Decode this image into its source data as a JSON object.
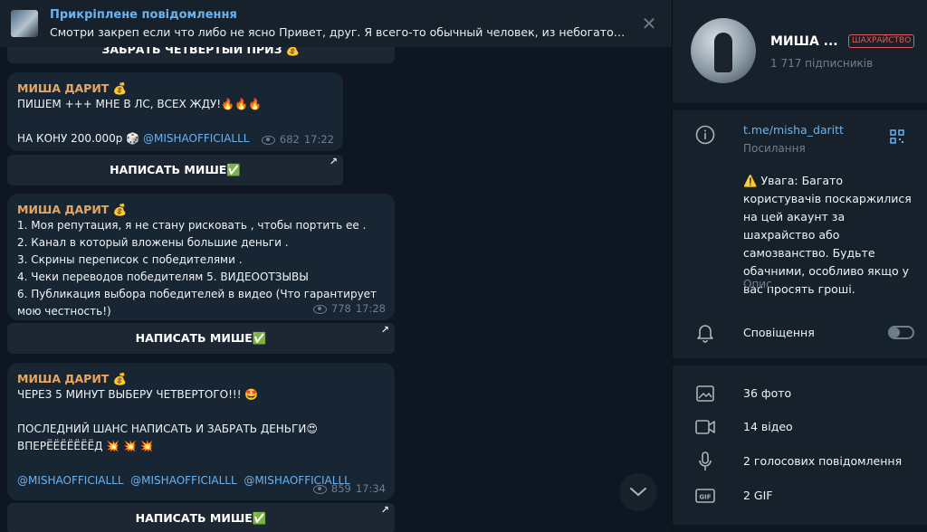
{
  "pinned": {
    "title": "Прикріплене повідомлення",
    "text": "Смотри закреп если что либо не ясно  Привет, друг. Я всего-то обычный человек, из небогатой сем..."
  },
  "top_button_label": "ЗАБРАТЬ ЧЕТВЕРТЫЙ ПРИЗ 💰",
  "messages": [
    {
      "sender": "МИША ДАРИТ 💰",
      "lines": [
        "ПИШЕМ +++ МНЕ В ЛС, ВСЕХ ЖДУ!🔥🔥🔥",
        "",
        "НА КОНУ 200.000р 🎲 "
      ],
      "link": "@MISHAOFFICIALLL",
      "views": "682",
      "time": "17:22",
      "button": "НАПИСАТЬ МИШЕ✅"
    },
    {
      "sender": "МИША ДАРИТ 💰",
      "lines": [
        "1. Моя репутация, я не стану рисковать , чтобы портить ее .",
        "2. Канал в который вложены большие деньги .",
        "3. Скрины переписок с победителями .",
        "4. Чеки переводов победителям 5. ВИДЕООТЗЫВЫ",
        "6. Публикация выбора победителей в видео (Что гарантирует",
        "мою честность!)"
      ],
      "views": "778",
      "time": "17:28",
      "button": "НАПИСАТЬ МИШЕ✅"
    },
    {
      "sender": "МИША ДАРИТ 💰",
      "lines": [
        "ЧЕРЕЗ 5 МИНУТ ВЫБЕРУ ЧЕТВЕРТОГО!!! 🤩",
        "",
        "ПОСЛЕДНИЙ ШАНС НАПИСАТЬ И ЗАБРАТЬ ДЕНЬГИ😍",
        "ВПЕРЁЁЁЁЁЁЁД 💥 💥 💥",
        ""
      ],
      "links": [
        "@MISHAOFFICIALLL",
        "@MISHAOFFICIALLL",
        "@MISHAOFFICIALLL"
      ],
      "views": "859",
      "time": "17:34",
      "button": "НАПИСАТЬ МИШЕ✅"
    }
  ],
  "channel": {
    "name": "МИША ...",
    "scam_badge": "ШАХРАЙСТВО",
    "subscribers": "1 717 підписників",
    "link": "t.me/misha_daritt",
    "link_label": "Посилання",
    "description": "⚠️ Увага: Багато користувачів поскаржилися на цей акаунт за шахрайство або самозванство. Будьте обачними, особливо якщо у вас просять гроші.",
    "description_label": "Опис",
    "notifications_label": "Сповіщення",
    "notifications_on": false,
    "media": [
      {
        "icon": "photo-icon",
        "label": "36 фото"
      },
      {
        "icon": "video-icon",
        "label": "14 відео"
      },
      {
        "icon": "microphone-icon",
        "label": "2 голосових повідомлення"
      },
      {
        "icon": "gif-icon",
        "label": "2 GIF"
      }
    ]
  },
  "colors": {
    "background": "#0e1621",
    "panel": "#17212b",
    "bubble": "#182533",
    "accent": "#6ab3f3",
    "sender": "#e7a662",
    "scam": "#e35b5b"
  }
}
